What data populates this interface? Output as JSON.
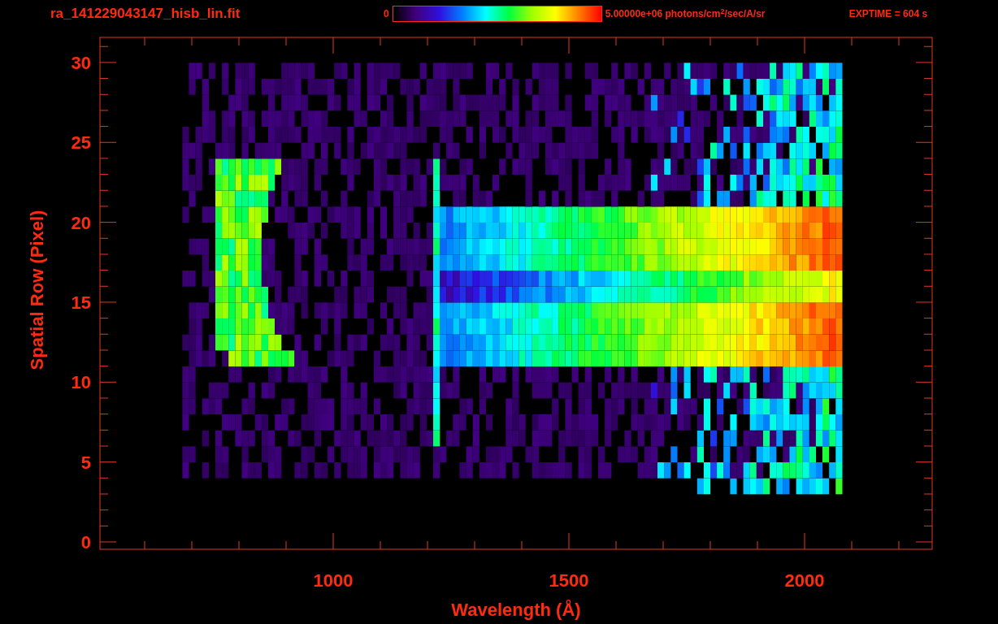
{
  "title": "ra_141229043147_hisb_lin.fit",
  "colorbar": {
    "min_label": "0",
    "max_label": "5.00000e+06 photons/cm$^{2}$/sec/A/sr"
  },
  "exposure": "EXPTIME = 604 s",
  "plot": {
    "xlabel": "Wavelength (Å)",
    "ylabel": "Spatial Row (Pixel)",
    "xticks": [
      "1000",
      "1500",
      "2000"
    ],
    "yticks": [
      "30",
      "25",
      "20",
      "15",
      "10",
      "5",
      "0"
    ]
  }
}
